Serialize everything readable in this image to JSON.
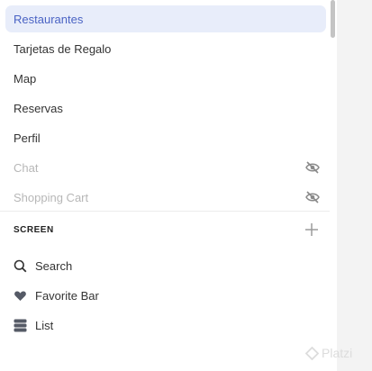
{
  "menu": {
    "items": [
      {
        "label": "Restaurantes",
        "state": "active"
      },
      {
        "label": "Tarjetas de Regalo",
        "state": "normal"
      },
      {
        "label": "Map",
        "state": "normal"
      },
      {
        "label": "Reservas",
        "state": "normal"
      },
      {
        "label": "Perfil",
        "state": "normal"
      },
      {
        "label": "Chat",
        "state": "hidden",
        "icon": "eye-off-icon"
      },
      {
        "label": "Shopping Cart",
        "state": "hidden",
        "icon": "eye-off-icon"
      }
    ]
  },
  "screen_section": {
    "title": "SCREEN",
    "add_icon": "plus-icon",
    "items": [
      {
        "label": "Search",
        "icon": "search-icon"
      },
      {
        "label": "Favorite Bar",
        "icon": "heart-icon"
      },
      {
        "label": "List",
        "icon": "list-icon"
      }
    ]
  },
  "watermark": {
    "text": "Platzi"
  },
  "colors": {
    "active_bg": "#e8edfa",
    "active_text": "#4a63c4",
    "disabled_text": "#b7b7b7"
  }
}
